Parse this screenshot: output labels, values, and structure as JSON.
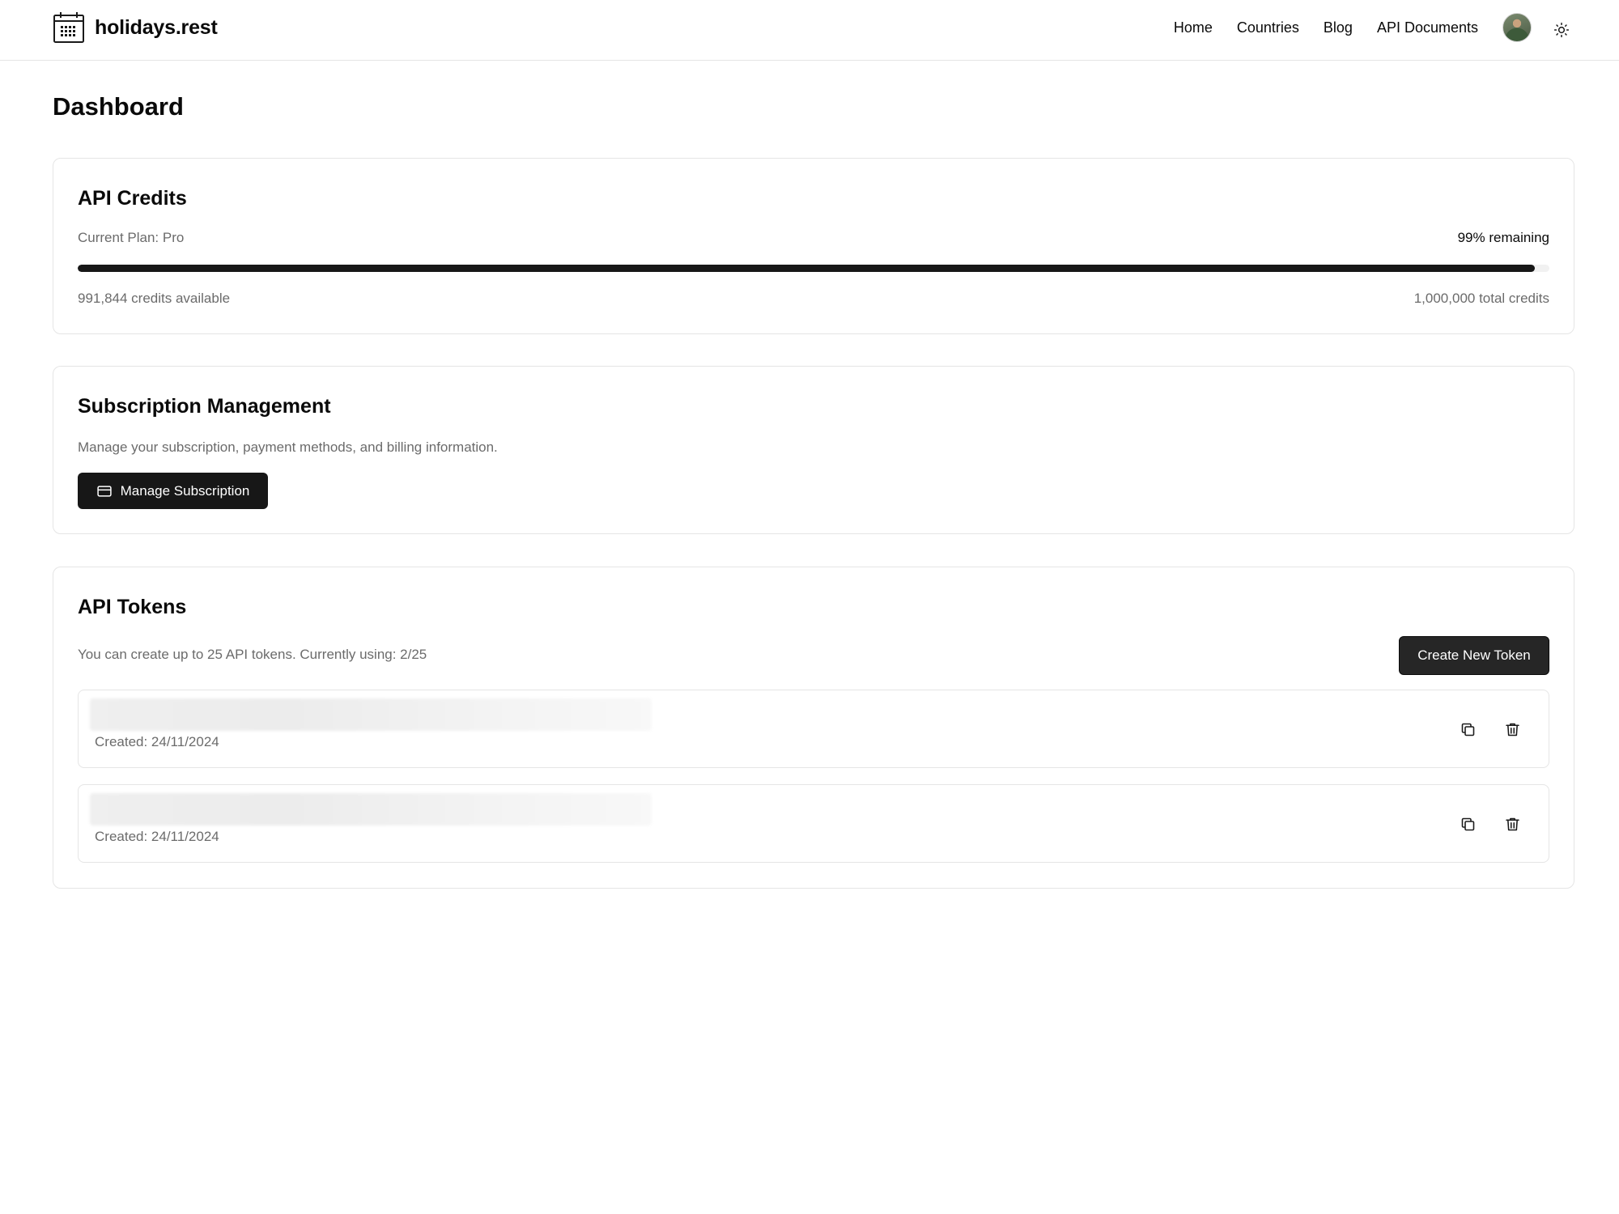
{
  "header": {
    "brand_name": "holidays.rest",
    "nav": [
      {
        "label": "Home"
      },
      {
        "label": "Countries"
      },
      {
        "label": "Blog"
      },
      {
        "label": "API Documents"
      }
    ],
    "icons": {
      "logo": "calendar-icon",
      "theme_toggle": "sun-icon",
      "avatar": "user-avatar"
    }
  },
  "page": {
    "title": "Dashboard"
  },
  "credits": {
    "title": "API Credits",
    "plan": "Current Plan: Pro",
    "remaining": "99% remaining",
    "remaining_fraction": 0.99,
    "available": "991,844 credits available",
    "total": "1,000,000 total credits"
  },
  "subscription": {
    "title": "Subscription Management",
    "description": "Manage your subscription, payment methods, and billing information.",
    "button_label": "Manage Subscription",
    "button_icon": "credit-card-icon"
  },
  "tokens": {
    "title": "API Tokens",
    "description": "You can create up to 25 API tokens. Currently using: 2/25",
    "create_label": "Create New Token",
    "items": [
      {
        "created": "Created: 24/11/2024"
      },
      {
        "created": "Created: 24/11/2024"
      }
    ],
    "row_icons": {
      "copy": "copy-icon",
      "delete": "trash-icon"
    }
  },
  "colors": {
    "accent": "#171717",
    "border": "#e5e5e5",
    "muted_text": "#6b6b6b"
  }
}
